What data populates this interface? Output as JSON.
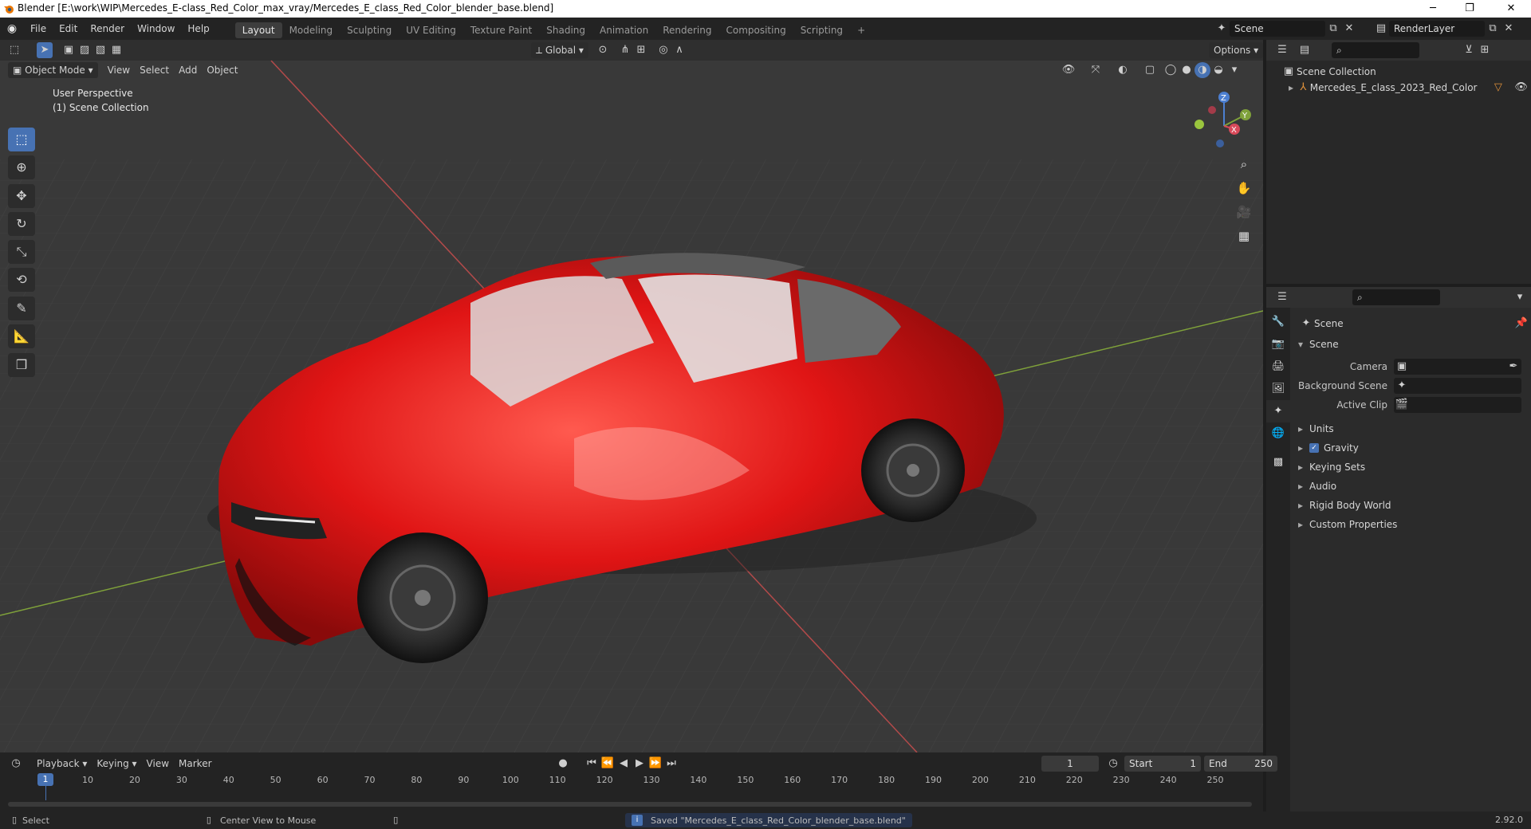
{
  "window": {
    "title": "Blender [E:\\work\\WIP\\Mercedes_E-class_Red_Color_max_vray/Mercedes_E_class_Red_Color_blender_base.blend]",
    "controls": [
      "─",
      "❐",
      "✕"
    ]
  },
  "menubar": {
    "menus": [
      "File",
      "Edit",
      "Render",
      "Window",
      "Help"
    ],
    "workspaces": [
      "Layout",
      "Modeling",
      "Sculpting",
      "UV Editing",
      "Texture Paint",
      "Shading",
      "Animation",
      "Rendering",
      "Compositing",
      "Scripting"
    ],
    "active_workspace": "Layout",
    "add_tab": "+",
    "scene_name": "Scene",
    "render_layer": "RenderLayer"
  },
  "viewport": {
    "mode": "Object Mode",
    "menus": [
      "View",
      "Select",
      "Add",
      "Object"
    ],
    "transform_orientation": "Global",
    "options_label": "Options",
    "overlay_text_1": "User Perspective",
    "overlay_text_2": "(1) Scene Collection",
    "gizmo": {
      "z": "Z",
      "y": "Y",
      "x": "X"
    }
  },
  "outliner": {
    "root": "Scene Collection",
    "items": [
      {
        "label": "Mercedes_E_class_2023_Red_Color"
      }
    ]
  },
  "properties": {
    "context": "Scene",
    "panel": "Scene",
    "fields": [
      {
        "label": "Camera"
      },
      {
        "label": "Background Scene"
      },
      {
        "label": "Active Clip"
      }
    ],
    "subpanels": [
      "Units",
      "Gravity",
      "Keying Sets",
      "Audio",
      "Rigid Body World",
      "Custom Properties"
    ],
    "gravity_checked": true
  },
  "timeline": {
    "menus": [
      "Playback",
      "Keying",
      "View",
      "Marker"
    ],
    "current_frame": "1",
    "start_label": "Start",
    "start": "1",
    "end_label": "End",
    "end": "250",
    "ticks": [
      1,
      10,
      20,
      30,
      40,
      50,
      60,
      70,
      80,
      90,
      100,
      110,
      120,
      130,
      140,
      150,
      160,
      170,
      180,
      190,
      200,
      210,
      220,
      230,
      240,
      250
    ]
  },
  "statusbar": {
    "select": "Select",
    "center_view": "Center View to Mouse",
    "message": "Saved \"Mercedes_E_class_Red_Color_blender_base.blend\"",
    "version": "2.92.0"
  },
  "colors": {
    "accent": "#4772b3",
    "car_red": "#e01515",
    "axis_x": "#b34a4a",
    "axis_y": "#7fa13a"
  }
}
